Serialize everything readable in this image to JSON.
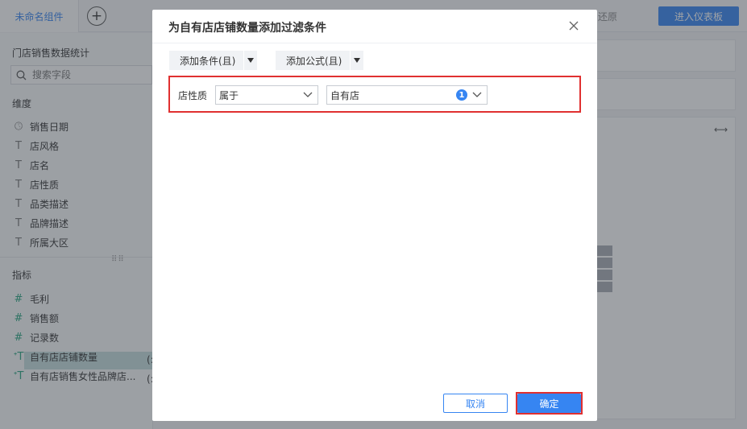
{
  "topbar": {
    "active_tab": "未命名组件",
    "add_tab_icon": "plus-circle-icon",
    "undo_label": "还原",
    "enter_dashboard_label": "进入仪表板"
  },
  "sidebar": {
    "dataset_title": "门店销售数据统计",
    "search_placeholder": "搜索字段",
    "dimension_heading": "维度",
    "dimensions": [
      {
        "icon": "clock-icon",
        "label": "销售日期"
      },
      {
        "icon": "text-icon",
        "label": "店风格"
      },
      {
        "icon": "text-icon",
        "label": "店名"
      },
      {
        "icon": "text-icon",
        "label": "店性质"
      },
      {
        "icon": "text-icon",
        "label": "品类描述"
      },
      {
        "icon": "text-icon",
        "label": "品牌描述"
      },
      {
        "icon": "text-icon",
        "label": "所属大区"
      }
    ],
    "metric_heading": "指标",
    "metrics": [
      {
        "icon": "hash-icon",
        "label": "毛利"
      },
      {
        "icon": "hash-icon",
        "label": "销售额"
      },
      {
        "icon": "hash-icon",
        "label": "记录数"
      },
      {
        "icon": "formula-text-icon",
        "label": "自有店店铺数量"
      },
      {
        "icon": "formula-text-icon",
        "label": "自有店销售女性品牌店..."
      }
    ],
    "truncated_marks": [
      "(:",
      "(:"
    ]
  },
  "dialog": {
    "title": "为自有店店铺数量添加过滤条件",
    "add_condition_label": "添加条件(且)",
    "add_formula_label": "添加公式(且)",
    "condition": {
      "field_label": "店性质",
      "operator_value": "属于",
      "value_text": "自有店",
      "selected_count": "1"
    },
    "cancel_label": "取消",
    "confirm_label": "确定"
  },
  "colors": {
    "accent": "#3685f2",
    "highlight_outline": "#e03030",
    "selected_field_bg": "#c5dede"
  }
}
